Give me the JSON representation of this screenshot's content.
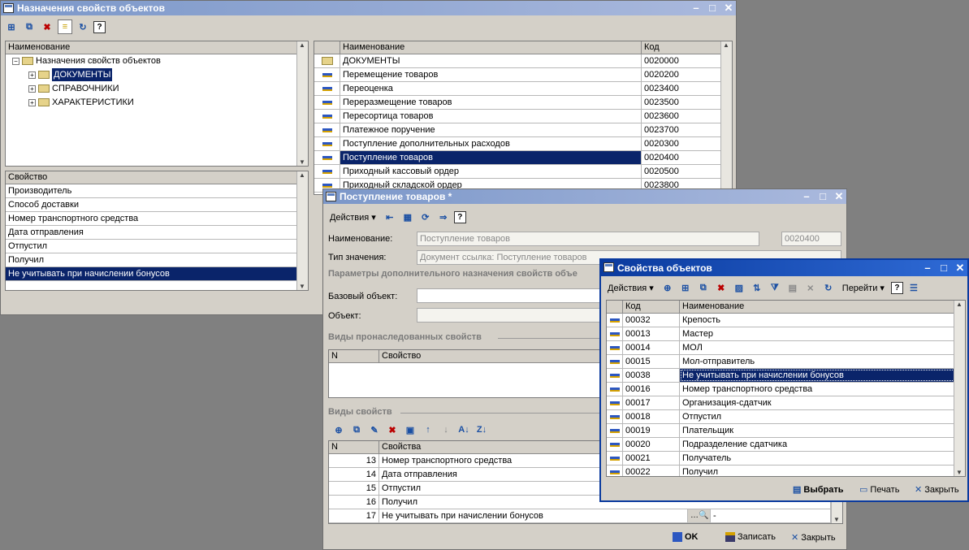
{
  "win1": {
    "title": "Назначения свойств объектов",
    "tree": {
      "header": "Наименование",
      "root": "Назначения свойств объектов",
      "items": [
        "ДОКУМЕНТЫ",
        "СПРАВОЧНИКИ",
        "ХАРАКТЕРИСТИКИ"
      ]
    },
    "props": {
      "header": "Свойство",
      "rows": [
        "Производитель",
        "Способ доставки",
        "Номер транспортного средства",
        "Дата отправления",
        "Отпустил",
        "Получил",
        "Не учитывать при начислении бонусов"
      ]
    },
    "list": {
      "col_name": "Наименование",
      "col_code": "Код",
      "rows": [
        {
          "name": "ДОКУМЕНТЫ",
          "code": "0020000"
        },
        {
          "name": "Перемещение товаров",
          "code": "0020200"
        },
        {
          "name": "Переоценка",
          "code": "0023400"
        },
        {
          "name": "Переразмещение товаров",
          "code": "0023500"
        },
        {
          "name": "Пересортица товаров",
          "code": "0023600"
        },
        {
          "name": "Платежное поручение",
          "code": "0023700"
        },
        {
          "name": "Поступление дополнительных расходов",
          "code": "0020300"
        },
        {
          "name": "Поступление товаров",
          "code": "0020400"
        },
        {
          "name": "Приходный кассовый ордер",
          "code": "0020500"
        },
        {
          "name": "Приходный складской ордер",
          "code": "0023800"
        }
      ]
    }
  },
  "win2": {
    "title": "Поступление товаров *",
    "actions_label": "Действия",
    "name_label": "Наименование:",
    "name_value": "Поступление товаров",
    "code_value": "0020400",
    "type_label": "Тип значения:",
    "type_value": "Документ ссылка: Поступление товаров",
    "section_params": "Параметры дополнительного назначения свойств объе",
    "base_object_label": "Базовый объект:",
    "object_label": "Объект:",
    "section_inherited": "Виды пронаследованных свойств",
    "inherited_cols": [
      "N",
      "Свойство"
    ],
    "section_kinds": "Виды свойств",
    "kinds_cols": [
      "N",
      "Свойства"
    ],
    "kinds_rows": [
      {
        "n": "13",
        "name": "Номер транспортного средства"
      },
      {
        "n": "14",
        "name": "Дата отправления"
      },
      {
        "n": "15",
        "name": "Отпустил"
      },
      {
        "n": "16",
        "name": "Получил"
      },
      {
        "n": "17",
        "name": "Не учитывать при начислении бонусов",
        "extra": "-"
      }
    ],
    "ok_label": "OK",
    "save_label": "Записать",
    "close_label": "Закрыть"
  },
  "win3": {
    "title": "Свойства объектов",
    "actions_label": "Действия",
    "goto_label": "Перейти",
    "col_code": "Код",
    "col_name": "Наименование",
    "rows": [
      {
        "code": "00032",
        "name": "Крепость"
      },
      {
        "code": "00013",
        "name": "Мастер"
      },
      {
        "code": "00014",
        "name": "МОЛ"
      },
      {
        "code": "00015",
        "name": "Мол-отправитель"
      },
      {
        "code": "00038",
        "name": "Не учитывать при начислении бонусов"
      },
      {
        "code": "00016",
        "name": "Номер транспортного средства"
      },
      {
        "code": "00017",
        "name": "Организация-сдатчик"
      },
      {
        "code": "00018",
        "name": "Отпустил"
      },
      {
        "code": "00019",
        "name": "Плательщик"
      },
      {
        "code": "00020",
        "name": "Подразделение сдатчика"
      },
      {
        "code": "00021",
        "name": "Получатель"
      },
      {
        "code": "00022",
        "name": "Получил"
      }
    ],
    "select_label": "Выбрать",
    "print_label": "Печать",
    "close_label": "Закрыть"
  },
  "colors": {
    "selection": "#0a246a",
    "window_bg": "#d4d0c8",
    "title_active": "#0a3a9e",
    "title_inactive": "#7b97c9"
  }
}
